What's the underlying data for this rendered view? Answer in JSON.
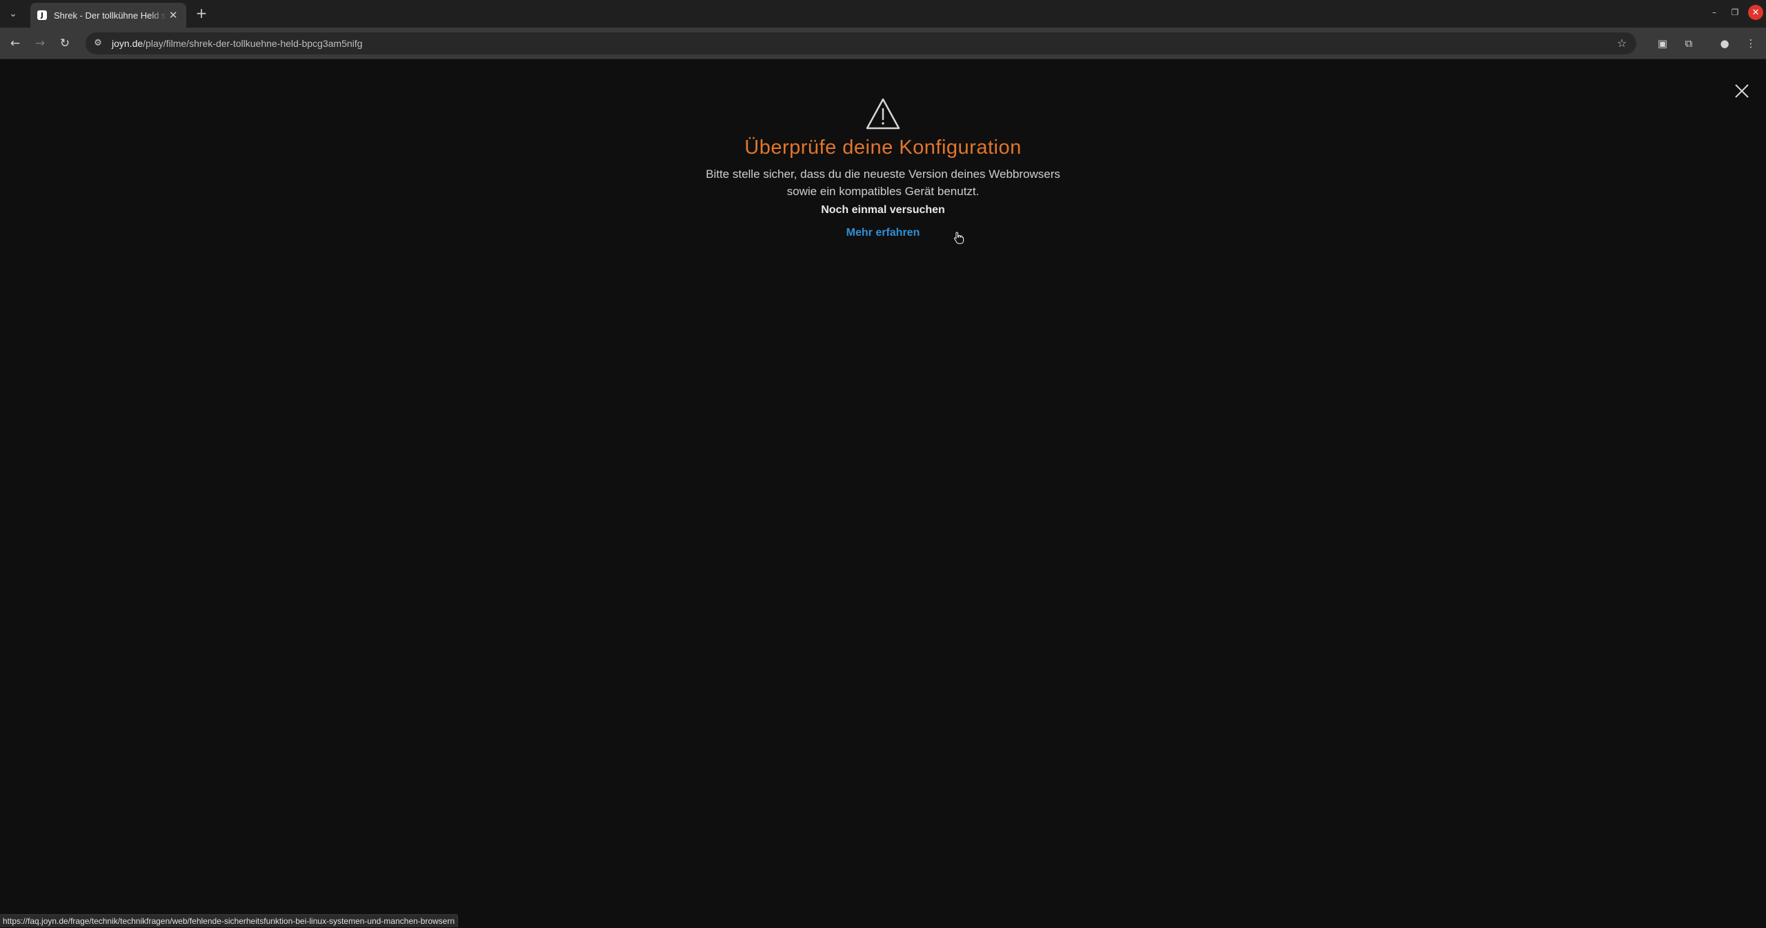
{
  "browser": {
    "tab": {
      "title": "Shrek - Der tollkühne Held stellt sich vor",
      "favicon_letter": "J"
    },
    "address": {
      "host": "joyn.de",
      "path": "/play/filme/shrek-der-tollkuehne-held-bpcg3am5nifg"
    },
    "status_url": "https://faq.joyn.de/frage/technik/technikfragen/web/fehlende-sicherheitsfunktion-bei-linux-systemen-und-manchen-browsern"
  },
  "error_dialog": {
    "headline": "Überprüfe deine Konfiguration",
    "message_line1": "Bitte stelle sicher, dass du die neueste Version deines Webbrowsers",
    "message_line2": "sowie ein kompatibles Gerät benutzt.",
    "retry_label": "Noch einmal versuchen",
    "learn_more_label": "Mehr erfahren"
  },
  "colors": {
    "background": "#0f0f0f",
    "headline": "#e2762b",
    "link": "#2f8fd8"
  },
  "icons": {
    "warning": "warning-triangle-icon",
    "close": "close-icon"
  }
}
